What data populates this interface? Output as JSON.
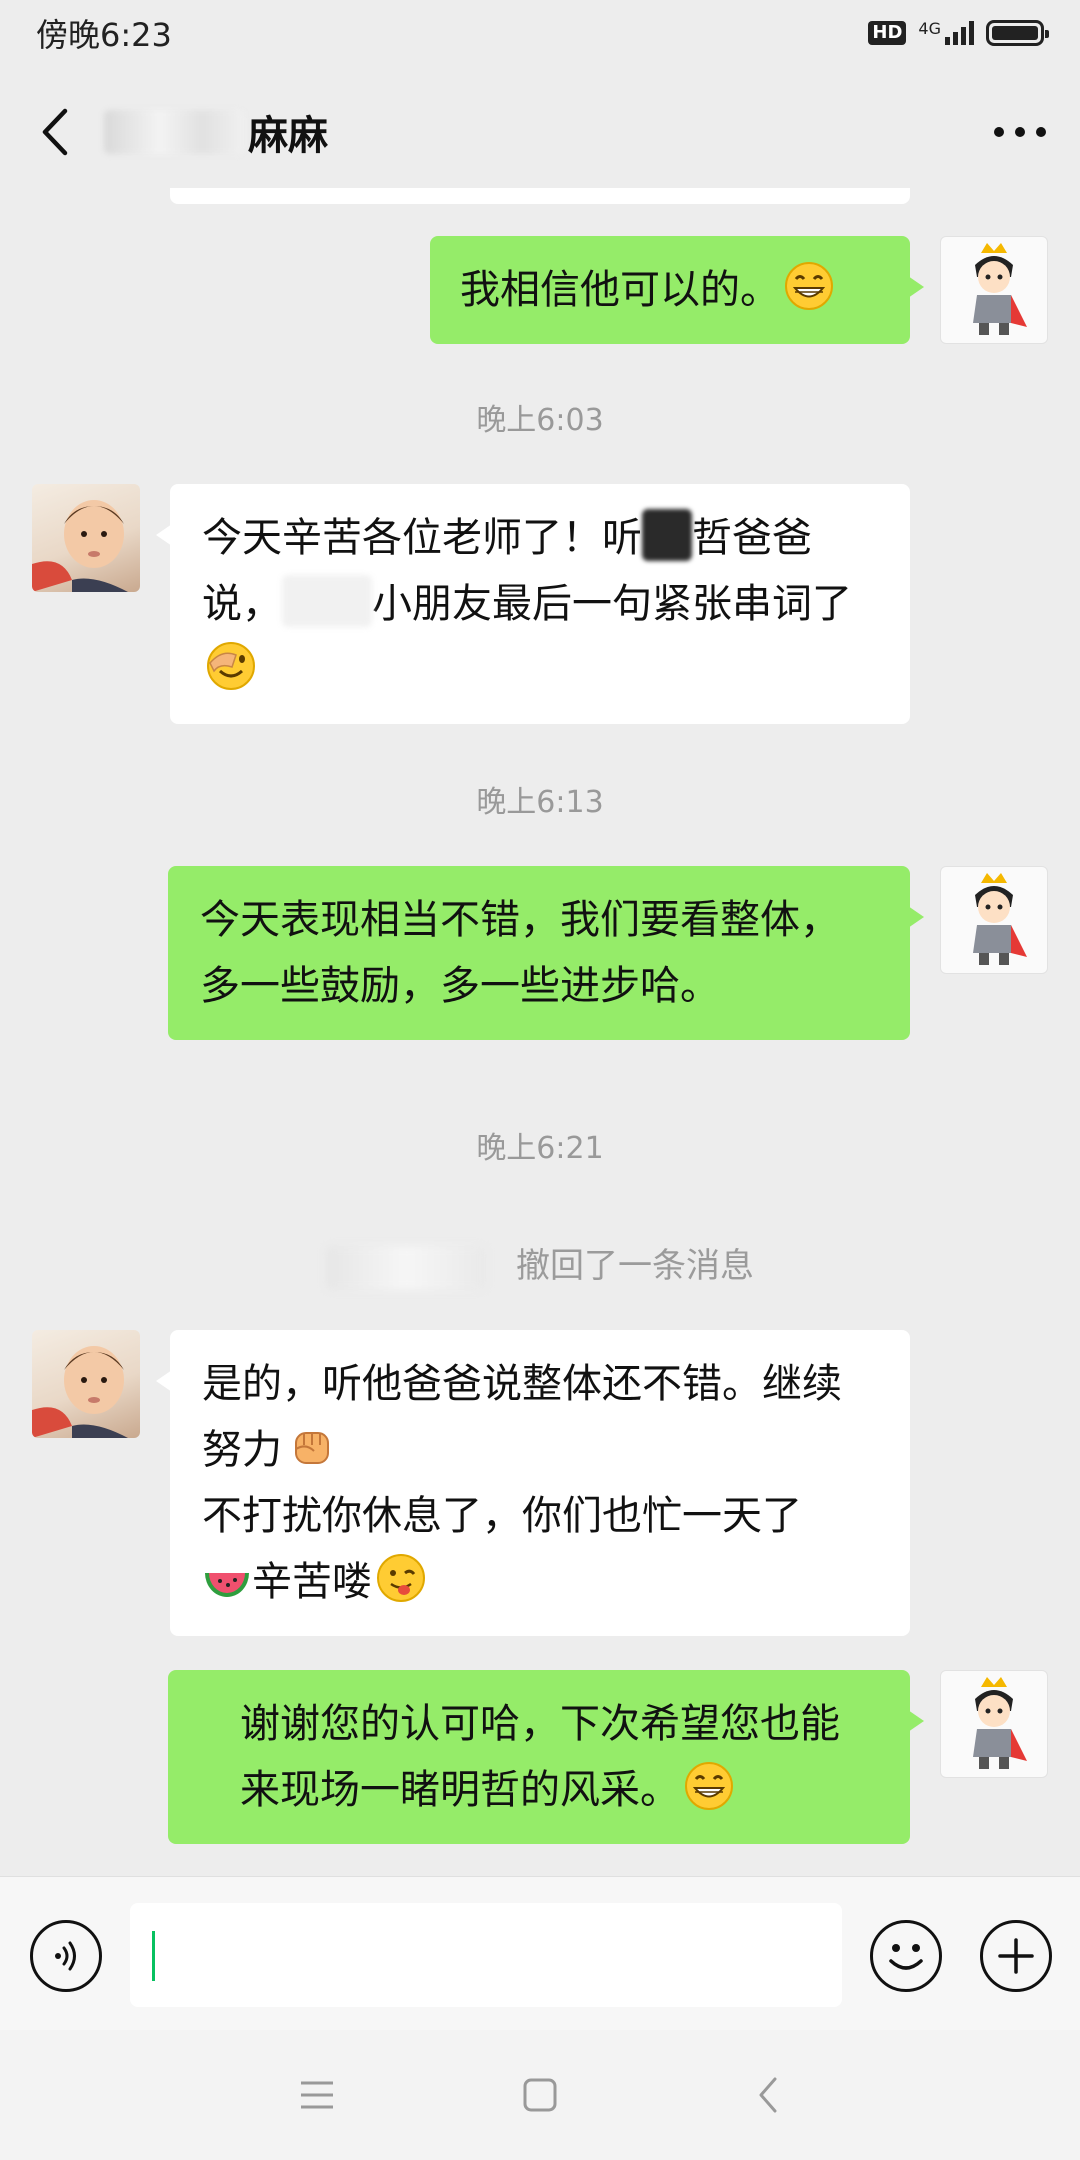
{
  "status_bar": {
    "time": "傍晚6:23",
    "hd_badge": "HD",
    "network": "4G",
    "battery_level": 1.0
  },
  "header": {
    "title_visible": "麻麻",
    "back_icon": "chevron-left-icon",
    "more_icon": "more-dots-icon"
  },
  "messages": [
    {
      "type": "out",
      "text": "我相信他可以的。",
      "emoji": "grin-emoji"
    },
    {
      "type": "time",
      "text": "晚上6:03"
    },
    {
      "type": "in",
      "part1": "今天辛苦各位老师了！听",
      "part2": "哲爸爸说，",
      "part3": "小朋友最后一句紧张串词了",
      "emoji": "facepalm-emoji"
    },
    {
      "type": "time",
      "text": "晚上6:13"
    },
    {
      "type": "out",
      "text": "今天表现相当不错，我们要看整体，多一些鼓励，多一些进步哈。"
    },
    {
      "type": "time",
      "text": "晚上6:21"
    },
    {
      "type": "recall",
      "text": "撤回了一条消息"
    },
    {
      "type": "in",
      "part1": "是的，听他爸爸说整体还不错。继续努力",
      "emoji1": "fist-emoji",
      "part2": "不打扰你休息了，你们也忙一天了",
      "emoji2": "watermelon-emoji",
      "part3": "辛苦喽",
      "emoji3": "wink-tongue-emoji"
    },
    {
      "type": "out",
      "text": "谢谢您的认可哈，下次希望您也能来现场一睹明哲的风采。",
      "emoji": "grin-emoji"
    }
  ],
  "input_bar": {
    "voice_icon": "voice-icon",
    "emoji_icon": "smile-icon",
    "plus_icon": "plus-icon",
    "value": ""
  },
  "nav_bar": {
    "menu_icon": "menu-icon",
    "home_icon": "home-icon",
    "back_icon": "back-icon"
  },
  "colors": {
    "background": "#ededed",
    "outgoing_bubble": "#95ec69",
    "incoming_bubble": "#ffffff",
    "timestamp": "#999999",
    "caret": "#07c160"
  }
}
